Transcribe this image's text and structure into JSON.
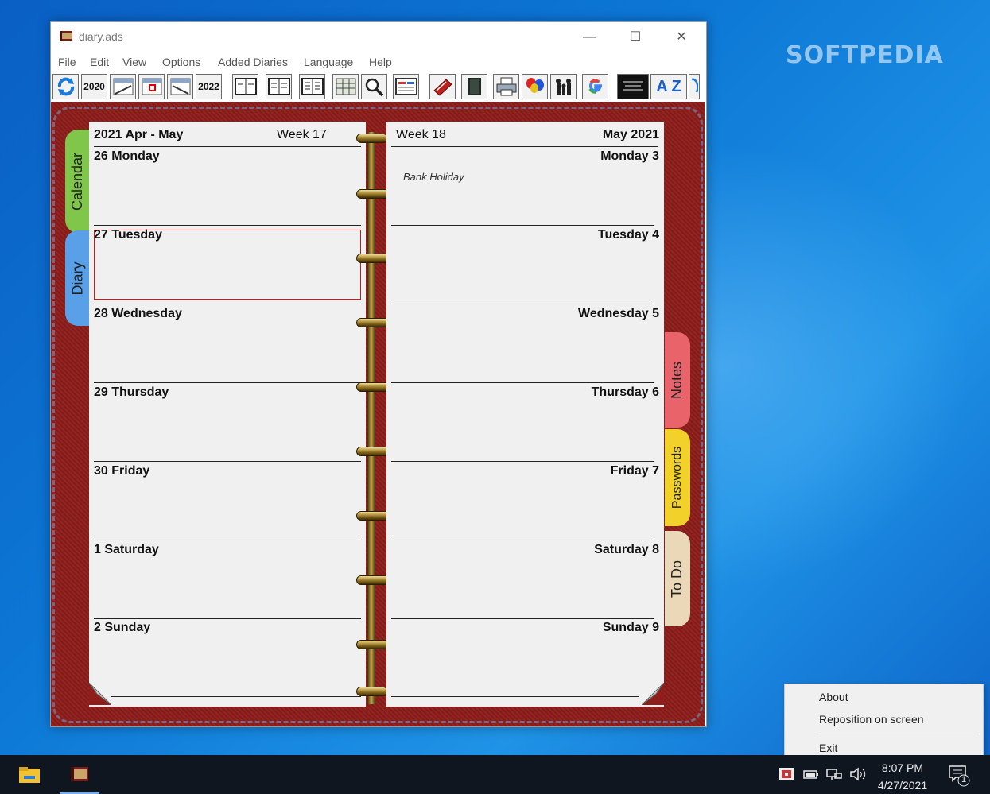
{
  "desktop": {
    "watermark": "SOFTPEDIA"
  },
  "window": {
    "title": "diary.ads",
    "controls": {
      "minimize": "—",
      "maximize": "☐",
      "close": "✕"
    }
  },
  "menu": [
    "File",
    "Edit",
    "View",
    "Options",
    "Added Diaries",
    "Language",
    "Help"
  ],
  "toolbar": {
    "year_prev": "2020",
    "year_next": "2022",
    "az": "A Z"
  },
  "left_page": {
    "header_range": "2021 Apr - May",
    "header_week": "Week 17",
    "days": [
      "26 Monday",
      "27 Tuesday",
      "28 Wednesday",
      "29 Thursday",
      "30 Friday",
      "1 Saturday",
      "2 Sunday"
    ]
  },
  "right_page": {
    "header_week": "Week 18",
    "header_month": "May 2021",
    "days": [
      "Monday 3",
      "Tuesday 4",
      "Wednesday 5",
      "Thursday 6",
      "Friday 7",
      "Saturday 8",
      "Sunday 9"
    ],
    "note_monday": "Bank Holiday"
  },
  "tabs": {
    "calendar": "Calendar",
    "diary": "Diary",
    "notes": "Notes",
    "passwords": "Passwords",
    "todo": "To Do"
  },
  "colors": {
    "calendar_tab": "#7fc64a",
    "diary_tab": "#5aa0e8",
    "notes_tab": "#e8636a",
    "passwords_tab": "#f2d22a",
    "todo_tab": "#ead8b8",
    "leather": "#8e1d1b"
  },
  "context_menu": {
    "items": [
      "About",
      "Reposition on screen",
      "Exit"
    ]
  },
  "taskbar": {
    "time": "8:07 PM",
    "date": "4/27/2021",
    "notifications": "1"
  }
}
